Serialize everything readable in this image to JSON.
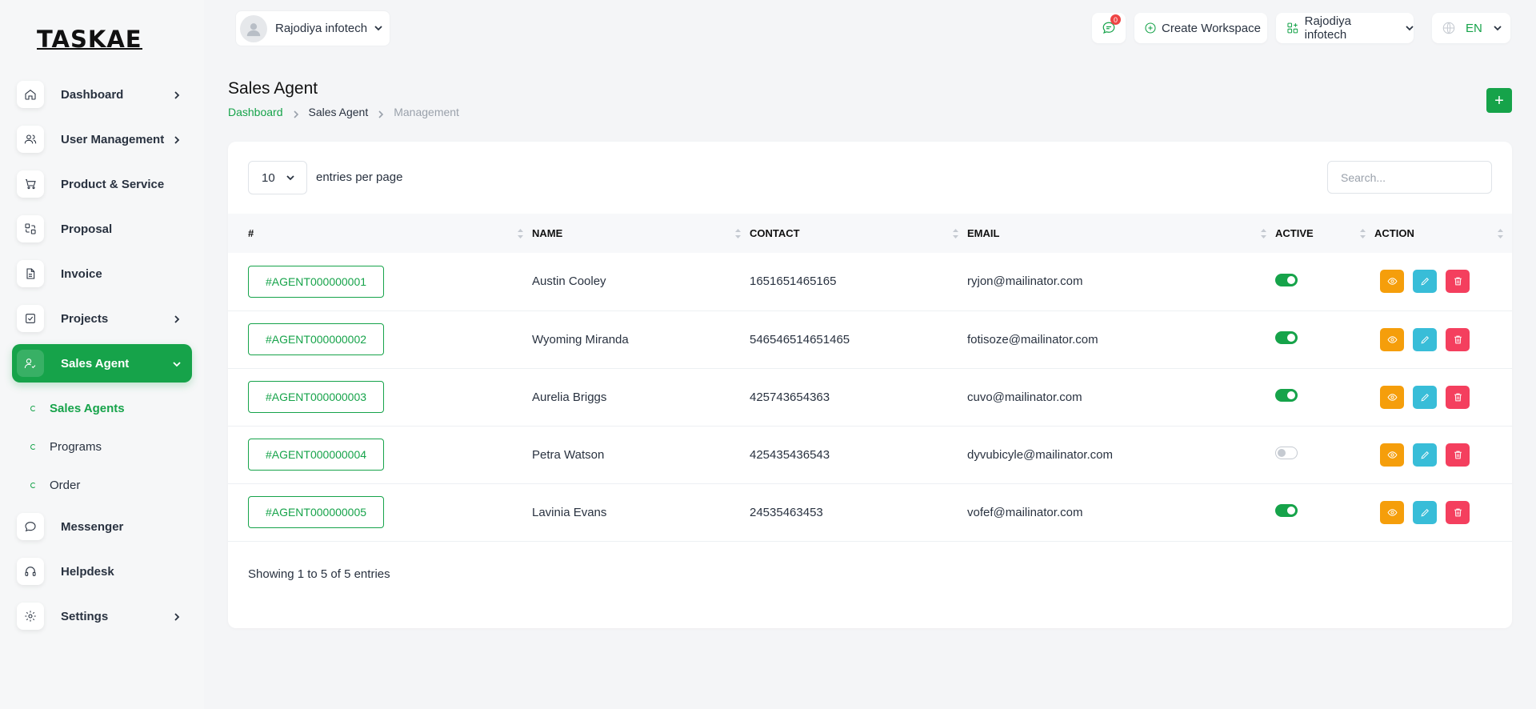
{
  "logo_text": "TASKAE",
  "sidebar": {
    "items": [
      {
        "label": "Dashboard",
        "icon": "home-icon",
        "has_children": true
      },
      {
        "label": "User Management",
        "icon": "users-icon",
        "has_children": true
      },
      {
        "label": "Product & Service",
        "icon": "cart-icon",
        "has_children": false
      },
      {
        "label": "Proposal",
        "icon": "proposal-icon",
        "has_children": false
      },
      {
        "label": "Invoice",
        "icon": "file-icon",
        "has_children": false
      },
      {
        "label": "Projects",
        "icon": "checkbox-icon",
        "has_children": true
      },
      {
        "label": "Sales Agent",
        "icon": "user-check-icon",
        "has_children": true,
        "active": true
      },
      {
        "label": "Messenger",
        "icon": "chat-icon",
        "has_children": false
      },
      {
        "label": "Helpdesk",
        "icon": "headphones-icon",
        "has_children": false
      },
      {
        "label": "Settings",
        "icon": "gear-icon",
        "has_children": true
      }
    ],
    "sub_items": [
      {
        "label": "Sales Agents",
        "current": true
      },
      {
        "label": "Programs",
        "current": false
      },
      {
        "label": "Order",
        "current": false
      }
    ]
  },
  "header": {
    "workspace_name": "Rajodiya infotech",
    "message_count": "0",
    "create_workspace_label": "Create Workspace",
    "org_name": "Rajodiya infotech",
    "language": "EN"
  },
  "page": {
    "title": "Sales Agent",
    "breadcrumb": [
      "Dashboard",
      "Sales Agent",
      "Management"
    ],
    "add_label": "+"
  },
  "table": {
    "per_page": "10",
    "per_page_label": "entries per page",
    "search_placeholder": "Search...",
    "columns": [
      "#",
      "NAME",
      "CONTACT",
      "EMAIL",
      "ACTIVE",
      "ACTION"
    ],
    "rows": [
      {
        "id": "#AGENT000000001",
        "name": "Austin Cooley",
        "contact": "1651651465165",
        "email": "ryjon@mailinator.com",
        "active": true
      },
      {
        "id": "#AGENT000000002",
        "name": "Wyoming Miranda",
        "contact": "546546514651465",
        "email": "fotisoze@mailinator.com",
        "active": true
      },
      {
        "id": "#AGENT000000003",
        "name": "Aurelia Briggs",
        "contact": "425743654363",
        "email": "cuvo@mailinator.com",
        "active": true
      },
      {
        "id": "#AGENT000000004",
        "name": "Petra Watson",
        "contact": "425435436543",
        "email": "dyvubicyle@mailinator.com",
        "active": false
      },
      {
        "id": "#AGENT000000005",
        "name": "Lavinia Evans",
        "contact": "24535463453",
        "email": "vofef@mailinator.com",
        "active": true
      }
    ],
    "footer": "Showing 1 to 5 of 5 entries"
  },
  "colors": {
    "brand": "#16a34a",
    "view": "#f59e0b",
    "edit": "#38bdd8",
    "delete": "#f43f5e"
  }
}
